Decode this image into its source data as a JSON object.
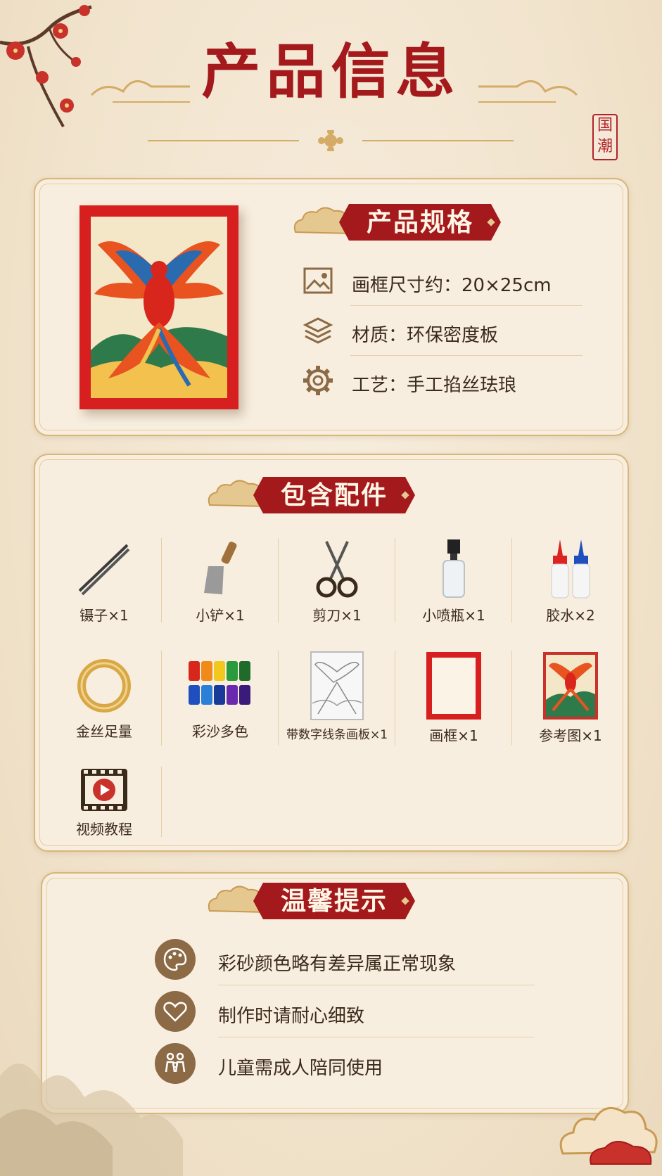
{
  "header": {
    "title": "产品信息",
    "seal_chars": [
      "国",
      "潮"
    ]
  },
  "specs": {
    "heading": "产品规格",
    "items": [
      {
        "icon": "image-icon",
        "text": "画框尺寸约：20×25cm"
      },
      {
        "icon": "layers-icon",
        "text": "材质：环保密度板"
      },
      {
        "icon": "gear-icon",
        "text": "工艺：手工掐丝珐琅"
      }
    ]
  },
  "accessories": {
    "heading": "包含配件",
    "items": [
      {
        "icon": "tweezers-icon",
        "label": "镊子×1"
      },
      {
        "icon": "shovel-icon",
        "label": "小铲×1"
      },
      {
        "icon": "scissors-icon",
        "label": "剪刀×1"
      },
      {
        "icon": "spray-bottle-icon",
        "label": "小喷瓶×1"
      },
      {
        "icon": "glue-bottles-icon",
        "label": "胶水×2"
      },
      {
        "icon": "gold-wire-icon",
        "label": "金丝足量"
      },
      {
        "icon": "colored-sand-icon",
        "label": "彩沙多色"
      },
      {
        "icon": "line-drawing-board-icon",
        "label": "带数字线条画板×1"
      },
      {
        "icon": "frame-icon",
        "label": "画框×1"
      },
      {
        "icon": "reference-image-icon",
        "label": "参考图×1"
      },
      {
        "icon": "video-play-icon",
        "label": "视频教程"
      }
    ]
  },
  "tips": {
    "heading": "温馨提示",
    "items": [
      {
        "icon": "palette-icon",
        "text": "彩砂颜色略有差异属正常现象"
      },
      {
        "icon": "heart-icon",
        "text": "制作时请耐心细致"
      },
      {
        "icon": "family-icon",
        "text": "儿童需成人陪同使用"
      }
    ]
  },
  "colors": {
    "accent_red": "#a3191c",
    "gold": "#d9b67a",
    "icon_brown": "#8b6a45",
    "background": "#f3e6d0"
  }
}
